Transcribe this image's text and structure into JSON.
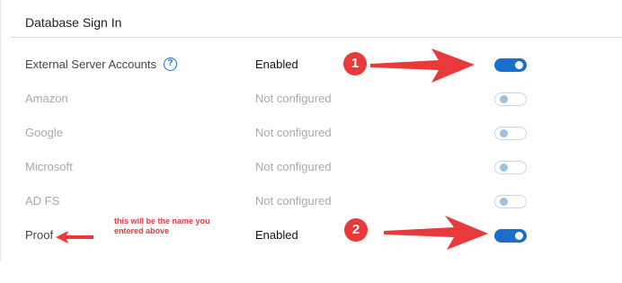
{
  "section": {
    "title": "Database Sign In"
  },
  "rows": [
    {
      "name": "External Server Accounts",
      "status": "Enabled",
      "enabled": true,
      "has_help": true
    },
    {
      "name": "Amazon",
      "status": "Not configured",
      "enabled": false
    },
    {
      "name": "Google",
      "status": "Not configured",
      "enabled": false
    },
    {
      "name": "Microsoft",
      "status": "Not configured",
      "enabled": false
    },
    {
      "name": "AD FS",
      "status": "Not configured",
      "enabled": false
    },
    {
      "name": "Proof",
      "status": "Enabled",
      "enabled": true
    }
  ],
  "help_icon": {
    "glyph": "?",
    "icon": "question-circle-icon"
  },
  "annotations": {
    "badge1": "1",
    "badge2": "2",
    "note": "this will be the name you entered above",
    "color": "#e8393b"
  },
  "colors": {
    "toggle_on": "#1a6fcb",
    "toggle_off_knob": "#9ec1e2",
    "help": "#1a72c4"
  }
}
